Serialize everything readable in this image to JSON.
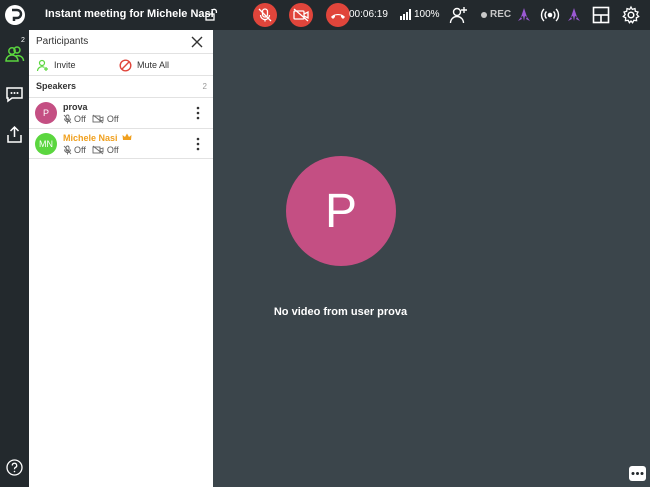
{
  "header": {
    "logo_icon": "jitsi-logo-icon",
    "title": "Instant meeting for Michele Nasi",
    "lock_icon": "unlock-icon",
    "timer": "00:06:19",
    "battery": "100%",
    "rec_label": "REC",
    "icons": [
      "mic-muted-icon",
      "camera-off-icon",
      "hangup-icon",
      "signal-icon",
      "add-person-icon",
      "purple-rocket-icon",
      "broadcast-icon",
      "layout-icon",
      "gear-icon"
    ]
  },
  "sidebar": {
    "participants_badge": "2",
    "icons": [
      "participants-icon",
      "chat-icon",
      "share-icon",
      "help-icon"
    ]
  },
  "panel": {
    "title": "Participants",
    "invite_label": "Invite",
    "mute_all_label": "Mute All",
    "section_label": "Speakers",
    "section_count": "2",
    "participants": [
      {
        "initials": "P",
        "name": "prova",
        "mic": "Off",
        "cam": "Off",
        "color": "#c44f83",
        "name_color": "#333333"
      },
      {
        "initials": "MN",
        "name": "Michele Nasi",
        "mic": "Off",
        "cam": "Off",
        "color": "#5bd63f",
        "name_color": "#f0a01e"
      }
    ]
  },
  "main": {
    "avatar_initial": "P",
    "no_video_text": "No video from user prova"
  },
  "colors": {
    "topbar": "#23292d",
    "stage": "#3b454b",
    "hangup": "#e0453b",
    "accent_green": "#5bd63f",
    "accent_purple": "#9b59d4"
  }
}
